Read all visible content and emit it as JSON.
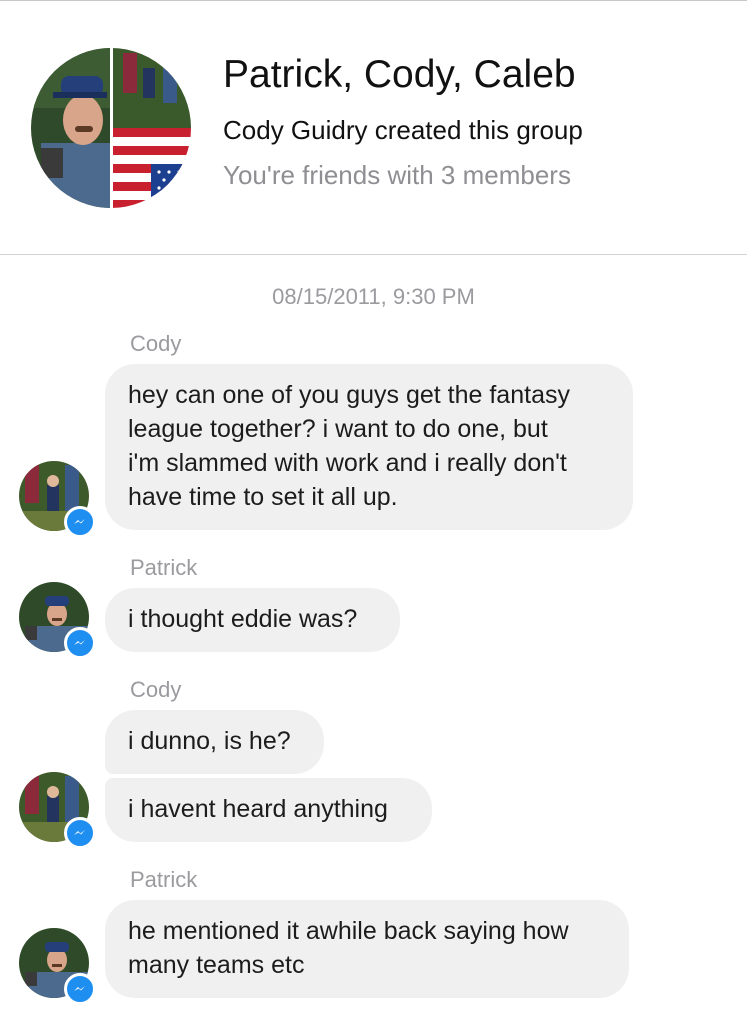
{
  "group": {
    "title": "Patrick, Cody, Caleb",
    "creator_line": "Cody Guidry created this group",
    "friends_line": "You're friends with 3 members"
  },
  "conversation": {
    "timestamp": "08/15/2011, 9:30 PM",
    "messages": [
      {
        "sender": "Cody",
        "text": "hey can one of you guys get the fantasy\nleague together? i want to do one, but\ni'm slammed with work and i really don't\nhave time to set it all up."
      },
      {
        "sender": "Patrick",
        "text": "i thought eddie was?"
      },
      {
        "sender": "Cody",
        "text": "i dunno, is he?"
      },
      {
        "sender": "Cody",
        "text": "i havent heard anything"
      },
      {
        "sender": "Patrick",
        "text": "he mentioned it awhile back saying how\nmany teams etc"
      }
    ]
  },
  "colors": {
    "bubble": "#f1f0f0",
    "messenger_badge": "#1f8ef1",
    "secondary_text": "#9a9a9f"
  },
  "icons": {
    "badge": "messenger-icon",
    "group_photo": "group-avatar"
  }
}
